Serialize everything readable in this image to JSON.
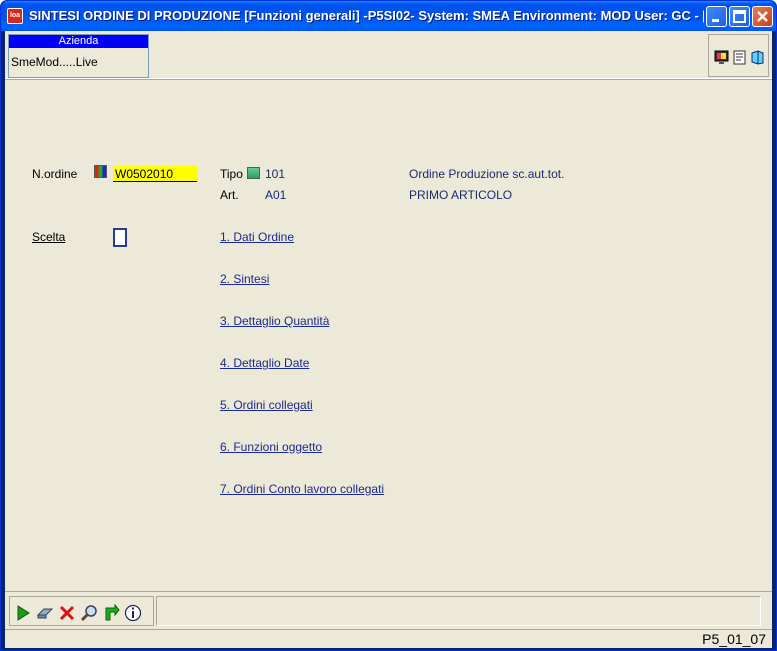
{
  "window": {
    "title": "SINTESI ORDINE DI PRODUZIONE [Funzioni generali] -P5SI02- System: SMEA Environment: MOD User: GC - [..."
  },
  "header": {
    "azienda_label": "Azienda",
    "azienda_value": "SmeMod.....Live"
  },
  "form": {
    "n_ordine_label": "N.ordine",
    "n_ordine_value": "W0502010",
    "tipo_label": "Tipo",
    "tipo_value": "101",
    "tipo_desc": "Ordine Produzione sc.aut.tot.",
    "art_label": "Art.",
    "art_value": "A01",
    "art_desc": "PRIMO ARTICOLO",
    "scelta_label": "Scelta"
  },
  "menu": [
    {
      "label": "1. Dati Ordine"
    },
    {
      "label": "2. Sintesi"
    },
    {
      "label": "3. Dettaglio Quantità"
    },
    {
      "label": "4. Dettaglio Date"
    },
    {
      "label": "5. Ordini collegati"
    },
    {
      "label": "6. Funzioni oggetto"
    },
    {
      "label": "7. Ordini Conto lavoro collegati"
    }
  ],
  "toolbar": {
    "icons": [
      "run-icon",
      "eraser-icon",
      "cancel-icon",
      "search-icon",
      "refresh-icon",
      "info-icon"
    ]
  },
  "status": {
    "code": "P5_01_07"
  },
  "colors": {
    "titlebar": "#0053ee",
    "client_bg": "#ece9d8",
    "input_highlight": "#ffff00",
    "azienda_header": "#0000ff",
    "link": "#1b2a8b"
  }
}
